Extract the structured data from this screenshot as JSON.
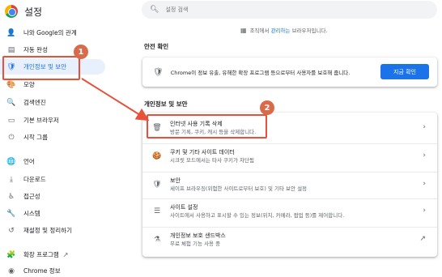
{
  "app": {
    "title": "설정"
  },
  "sidebar": {
    "items": [
      {
        "label": "나와 Google의 관계",
        "icon": "person-icon",
        "glyph": "👤"
      },
      {
        "label": "자동 완성",
        "icon": "autofill-icon",
        "glyph": "▤"
      },
      {
        "label": "개인정보 및 보안",
        "icon": "shield-icon",
        "glyph": "🛡"
      },
      {
        "label": "모양",
        "icon": "palette-icon",
        "glyph": "🎨"
      },
      {
        "label": "검색엔진",
        "icon": "search-icon",
        "glyph": "🔍"
      },
      {
        "label": "기본 브라우저",
        "icon": "browser-icon",
        "glyph": "▭"
      },
      {
        "label": "시작 그룹",
        "icon": "power-icon",
        "glyph": "⏻"
      },
      {
        "label": "언어",
        "icon": "globe-icon",
        "glyph": "🌐"
      },
      {
        "label": "다운로드",
        "icon": "download-icon",
        "glyph": "⤓"
      },
      {
        "label": "접근성",
        "icon": "accessibility-icon",
        "glyph": "♿"
      },
      {
        "label": "시스템",
        "icon": "wrench-icon",
        "glyph": "🔧"
      },
      {
        "label": "재설정 및 정리하기",
        "icon": "reset-icon",
        "glyph": "↺"
      },
      {
        "label": "확장 프로그램",
        "icon": "puzzle-icon",
        "glyph": "🧩"
      },
      {
        "label": "Chrome 정보",
        "icon": "chrome-icon",
        "glyph": "◉"
      }
    ],
    "external_icon": "↗"
  },
  "search": {
    "placeholder": "설정 검색"
  },
  "managed": {
    "prefix": "조직에서",
    "link": "관리하는",
    "suffix": "브라우저입니다."
  },
  "safety_check": {
    "heading": "안전 확인",
    "text": "Chrome이 정보 유출, 유해한 확장 프로그램 등으로부터 사용자를 보호해 줍니다.",
    "button": "지금 확인"
  },
  "privacy": {
    "heading": "개인정보 및 보안",
    "rows": [
      {
        "title": "인터넷 사용 기록 삭제",
        "subtitle": "방문 기록, 쿠키, 캐시 등을 삭제합니다.",
        "icon": "trash-icon",
        "glyph": "🗑",
        "trailing": "›"
      },
      {
        "title": "쿠키 및 기타 사이트 데이터",
        "subtitle": "시크릿 모드에서는 타사 쿠키가 차단됨",
        "icon": "cookie-icon",
        "glyph": "🍪",
        "trailing": "›"
      },
      {
        "title": "보안",
        "subtitle": "세이프 브라우징(위험한 사이트로부터 보호) 및 기타 보안 설정",
        "icon": "shield-icon",
        "glyph": "🛡",
        "trailing": "›"
      },
      {
        "title": "사이트 설정",
        "subtitle": "사이트에서 사용하고 표시할 수 있는 정보(위치, 카메라, 팝업 등)를 제어합니다.",
        "icon": "sliders-icon",
        "glyph": "☰",
        "trailing": "›"
      },
      {
        "title": "개인정보 보호 샌드박스",
        "subtitle": "무료 체험 기능 사용 중",
        "icon": "flask-icon",
        "glyph": "⚗",
        "trailing": "↗"
      }
    ]
  },
  "annotations": {
    "badge_1": "1",
    "badge_2": "2",
    "color": "#e8503a"
  }
}
